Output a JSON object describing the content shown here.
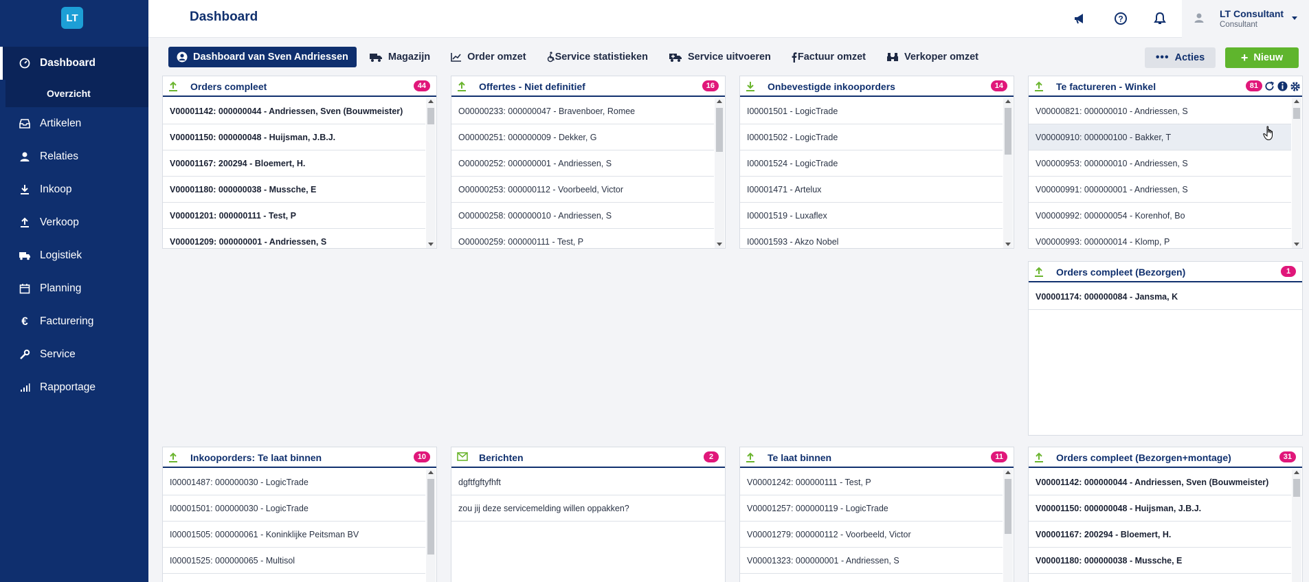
{
  "sidebar": {
    "logo": "LT",
    "items": [
      {
        "label": "Dashboard",
        "icon": "dashboard-icon",
        "active": true
      },
      {
        "label": "Overzicht",
        "sub": true
      },
      {
        "label": "Artikelen",
        "icon": "inbox-icon"
      },
      {
        "label": "Relaties",
        "icon": "user-icon"
      },
      {
        "label": "Inkoop",
        "icon": "download-icon"
      },
      {
        "label": "Verkoop",
        "icon": "upload-icon"
      },
      {
        "label": "Logistiek",
        "icon": "truck-icon"
      },
      {
        "label": "Planning",
        "icon": "calendar-icon"
      },
      {
        "label": "Facturering",
        "icon": "euro-icon"
      },
      {
        "label": "Service",
        "icon": "wrench-icon"
      },
      {
        "label": "Rapportage",
        "icon": "bar-chart-icon"
      }
    ]
  },
  "header": {
    "title": "Dashboard",
    "user_name": "LT Consultant",
    "user_role": "Consultant"
  },
  "toolbar": {
    "buttons": [
      {
        "label": "Dashboard van Sven Andriessen",
        "icon": "user-circle-icon",
        "primary": true
      },
      {
        "label": "Magazijn",
        "icon": "truck-icon"
      },
      {
        "label": "Order omzet",
        "icon": "line-chart-icon"
      },
      {
        "label": "Service statistieken",
        "icon": "wheelchair-icon"
      },
      {
        "label": "Service uitvoeren",
        "icon": "ambulance-icon"
      },
      {
        "label": "Factuur omzet",
        "icon": "facebook-f-icon"
      },
      {
        "label": "Verkoper omzet",
        "icon": "binoculars-icon"
      }
    ],
    "acties_label": "Acties",
    "nieuw_label": "Nieuw"
  },
  "widgets": {
    "w1": {
      "title": "Orders compleet",
      "count": "44",
      "rows": [
        "V00001142: 000000044 - Andriessen, Sven (Bouwmeister)",
        "V00001150: 000000048 - Huijsman, J.B.J.",
        "V00001167: 200294 - Bloemert, H.",
        "V00001180: 000000038 - Mussche, E",
        "V00001201: 000000111 - Test, P",
        "V00001209: 000000001 - Andriessen, S"
      ]
    },
    "w2": {
      "title": "Offertes - Niet definitief",
      "count": "16",
      "rows": [
        "O00000233: 000000047 - Bravenboer, Romee",
        "O00000251: 000000009 - Dekker, G",
        "O00000252: 000000001 - Andriessen, S",
        "O00000253: 000000112 - Voorbeeld, Victor",
        "O00000258: 000000010 - Andriessen, S",
        "O00000259: 000000111 - Test, P"
      ]
    },
    "w3": {
      "title": "Onbevestigde inkooporders",
      "count": "14",
      "rows": [
        "I00001501 - LogicTrade",
        "I00001502 - LogicTrade",
        "I00001524 - LogicTrade",
        "I00001471 - Artelux",
        "I00001519 - Luxaflex",
        "I00001593 - Akzo Nobel"
      ]
    },
    "w4": {
      "title": "Te factureren - Winkel",
      "count": "81",
      "rows": [
        "V00000821: 000000010 - Andriessen, S",
        "V00000910: 000000100 - Bakker, T",
        "V00000953: 000000010 - Andriessen, S",
        "V00000991: 000000001 - Andriessen, S",
        "V00000992: 000000054 - Korenhof, Bo",
        "V00000993: 000000014 - Klomp, P"
      ]
    },
    "w5": {
      "title": "Orders compleet (Bezorgen)",
      "count": "1",
      "rows": [
        "V00001174: 000000084 - Jansma, K"
      ]
    },
    "w6": {
      "title": "Inkooporders: Te laat binnen",
      "count": "10",
      "rows": [
        "I00001487: 000000030 - LogicTrade",
        "I00001501: 000000030 - LogicTrade",
        "I00001505: 000000061 - Koninklijke Peitsman BV",
        "I00001525: 000000065 - Multisol"
      ]
    },
    "w7": {
      "title": "Berichten",
      "count": "2",
      "rows": [
        "dgftfgftyfhft",
        "zou jij deze servicemelding willen oppakken?"
      ]
    },
    "w8": {
      "title": "Te laat binnen",
      "count": "11",
      "rows": [
        "V00001242: 000000111 - Test, P",
        "V00001257: 000000119 - LogicTrade",
        "V00001279: 000000112 - Voorbeeld, Victor",
        "V00001323: 000000001 - Andriessen, S"
      ]
    },
    "w9": {
      "title": "Orders compleet (Bezorgen+montage)",
      "count": "31",
      "rows": [
        "V00001142: 000000044 - Andriessen, Sven (Bouwmeister)",
        "V00001150: 000000048 - Huijsman, J.B.J.",
        "V00001167: 200294 - Bloemert, H.",
        "V00001180: 000000038 - Mussche, E"
      ]
    }
  },
  "colors": {
    "sidebar": "#0f2f6e",
    "accent_green": "#5fb52d",
    "badge": "#e0177a"
  }
}
